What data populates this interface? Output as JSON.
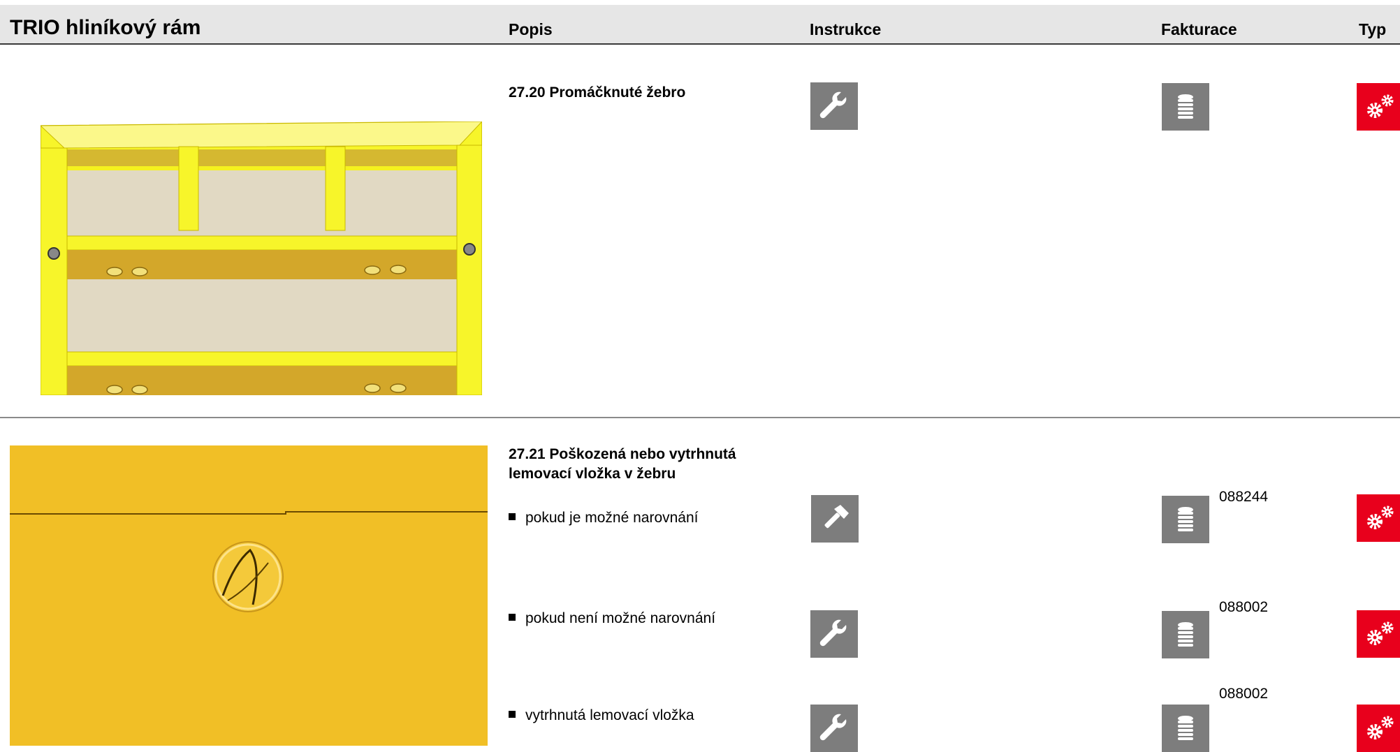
{
  "header": {
    "title": "TRIO hliníkový rám",
    "col_popis": "Popis",
    "col_instrukce": "Instrukce",
    "col_fakturace": "Fakturace",
    "col_typ": "Typ"
  },
  "sections": [
    {
      "heading": "27.20 Promáčknuté žebro",
      "rows": [
        {
          "text": "",
          "instruction_icon": "wrench-icon",
          "billing_icon": "coin-stack-icon",
          "code": "",
          "type_icon": "gears-icon"
        }
      ]
    },
    {
      "heading_line1": "27.21 Poškozená nebo vytrhnutá",
      "heading_line2": "lemovací vložka v žebru",
      "rows": [
        {
          "text": "pokud je možné narovnání",
          "instruction_icon": "hammer-icon",
          "billing_icon": "coin-stack-icon",
          "code": "088244",
          "type_icon": "gears-icon"
        },
        {
          "text": "pokud není možné narovnání",
          "instruction_icon": "wrench-icon",
          "billing_icon": "coin-stack-icon",
          "code": "088002",
          "type_icon": "gears-icon"
        },
        {
          "text": "vytrhnutá lemovací vložka",
          "instruction_icon": "wrench-icon",
          "billing_icon": "coin-stack-icon",
          "code": "088002",
          "type_icon": "gears-icon"
        }
      ]
    }
  ],
  "colors": {
    "header_bg": "#e6e6e6",
    "icon_tile_grey": "#7d7d7d",
    "type_red": "#e8001c",
    "frame_yellow": "#f5f21e",
    "panel_yellow": "#f1bf26"
  }
}
